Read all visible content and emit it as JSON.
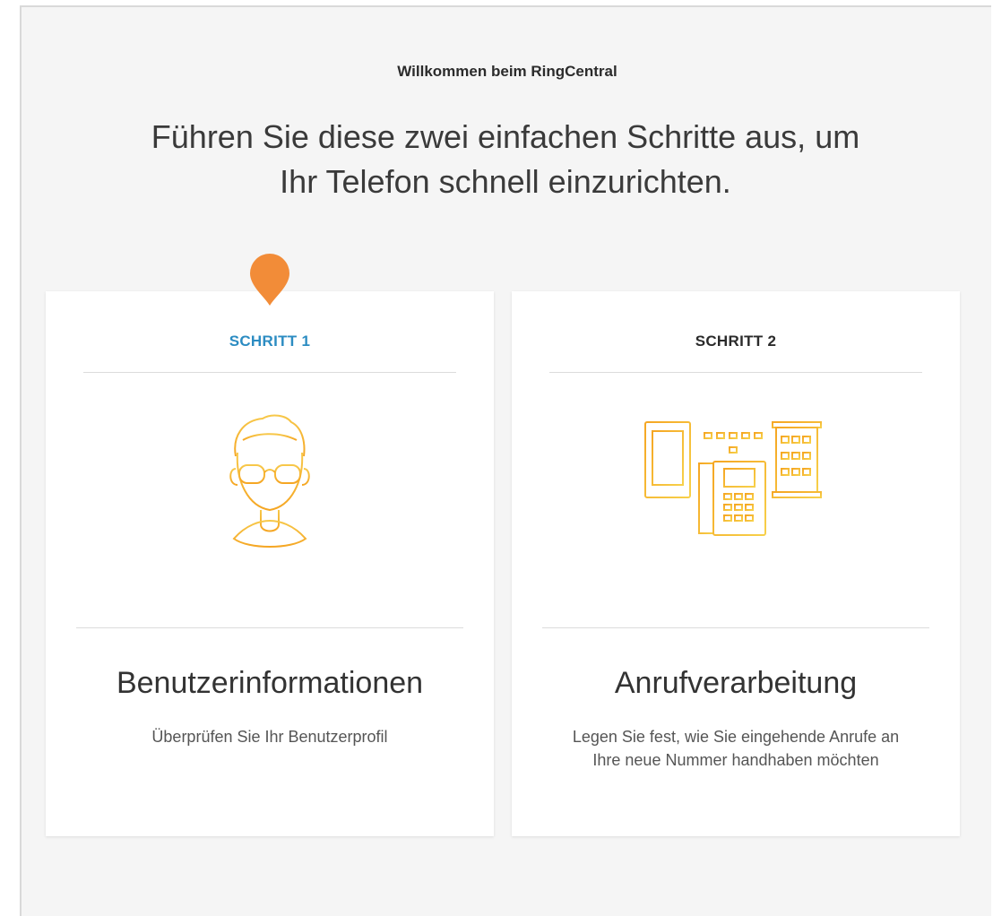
{
  "header": {
    "welcome": "Willkommen beim RingCentral",
    "subtitle_line1": "Führen Sie diese zwei einfachen Schritte aus, um",
    "subtitle_line2": "Ihr Telefon schnell einzurichten."
  },
  "steps": [
    {
      "label": "SCHRITT 1",
      "active": true,
      "icon": "user-profile-icon",
      "title": "Benutzerinformationen",
      "description": "Überprüfen Sie Ihr Benutzerprofil"
    },
    {
      "label": "SCHRITT 2",
      "active": false,
      "icon": "devices-icon",
      "title": "Anrufverarbeitung",
      "description": "Legen Sie fest, wie Sie eingehende Anrufe an Ihre neue Nummer handhaben möchten"
    }
  ],
  "colors": {
    "accent_orange": "#f28c38",
    "active_step": "#2c8cc2",
    "illustration_gradient_start": "#f5a623",
    "illustration_gradient_end": "#f7d04a"
  }
}
